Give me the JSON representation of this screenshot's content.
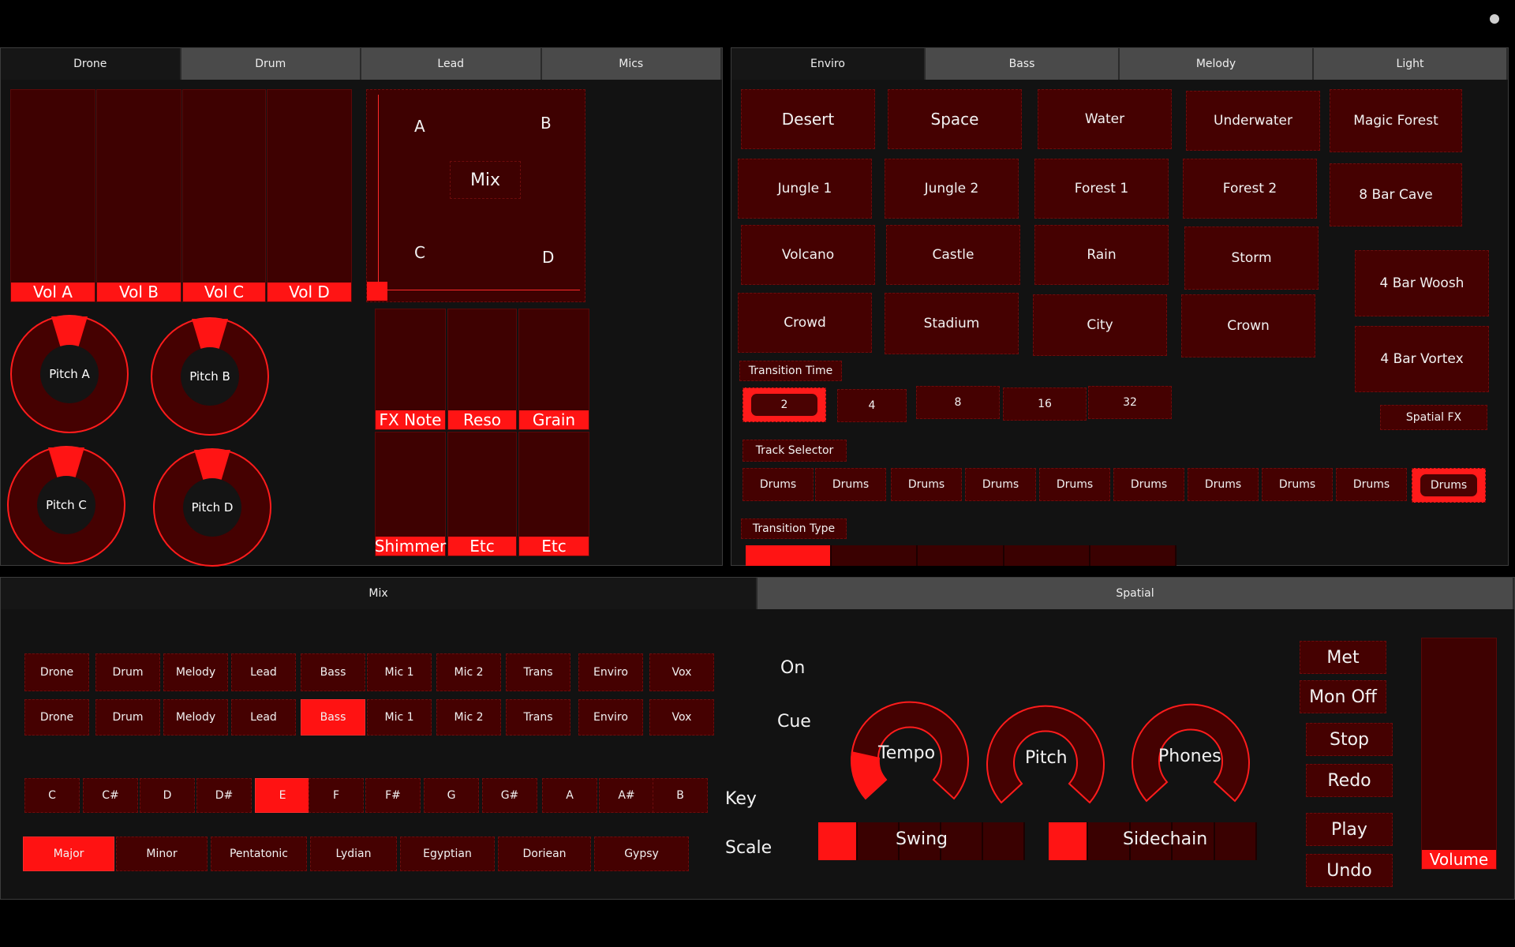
{
  "colors": {
    "accent": "#ff1414",
    "cell": "#450101",
    "cell_dark": "#3a0101",
    "panel": "#121212",
    "tab_inactive": "#4a4a4a"
  },
  "drone_panel": {
    "tabs": [
      "Drone",
      "Drum",
      "Lead",
      "Mics"
    ],
    "active_tab": "Drone",
    "vol_faders": [
      "Vol A",
      "Vol B",
      "Vol C",
      "Vol D"
    ],
    "xy_pad": {
      "a": "A",
      "b": "B",
      "c": "C",
      "d": "D",
      "center": "Mix"
    },
    "pitch_knobs": [
      "Pitch A",
      "Pitch B",
      "Pitch C",
      "Pitch D"
    ],
    "fx_faders_top": [
      "FX Note",
      "Reso",
      "Grain"
    ],
    "fx_faders_bottom": [
      "Shimmer",
      "Etc",
      "Etc"
    ]
  },
  "enviro_panel": {
    "tabs": [
      "Enviro",
      "Bass",
      "Melody",
      "Light"
    ],
    "active_tab": "Enviro",
    "environments": [
      "Desert",
      "Space",
      "Water",
      "Underwater",
      "Magic Forest",
      "Jungle 1",
      "Jungle 2",
      "Forest 1",
      "Forest 2",
      "8 Bar Cave",
      "Volcano",
      "Castle",
      "Rain",
      "Storm",
      "4 Bar Woosh",
      "Crowd",
      "Stadium",
      "City",
      "Crown",
      "4 Bar Vortex"
    ],
    "transition_time_label": "Transition Time",
    "transition_times": [
      "2",
      "4",
      "8",
      "16",
      "32"
    ],
    "transition_time_selected": "2",
    "spatial_fx_label": "Spatial FX",
    "track_selector_label": "Track Selector",
    "tracks": [
      "Drums",
      "Drums",
      "Drums",
      "Drums",
      "Drums",
      "Drums",
      "Drums",
      "Drums",
      "Drums",
      "Drums"
    ],
    "transition_type_label": "Transition Type",
    "transition_type_selected_index": 0
  },
  "mix_panel": {
    "tabs": [
      "Mix",
      "Spatial"
    ],
    "active_tab": "Mix",
    "channels_on": [
      "Drone",
      "Drum",
      "Melody",
      "Lead",
      "Bass",
      "Mic 1",
      "Mic 2",
      "Trans",
      "Enviro",
      "Vox"
    ],
    "channels_cue": [
      "Drone",
      "Drum",
      "Melody",
      "Lead",
      "Bass",
      "Mic 1",
      "Mic 2",
      "Trans",
      "Enviro",
      "Vox"
    ],
    "cue_selected": "Bass",
    "on_label": "On",
    "cue_label": "Cue",
    "keys": [
      "C",
      "C#",
      "D",
      "D#",
      "E",
      "F",
      "F#",
      "G",
      "G#",
      "A",
      "A#",
      "B"
    ],
    "key_selected": "E",
    "key_label": "Key",
    "scales": [
      "Major",
      "Minor",
      "Pentatonic",
      "Lydian",
      "Egyptian",
      "Doriean",
      "Gypsy"
    ],
    "scale_selected": "Major",
    "scale_label": "Scale",
    "knobs": [
      "Tempo",
      "Pitch",
      "Phones"
    ],
    "tempo_level": 0.2,
    "swing_label": "Swing",
    "sidechain_label": "Sidechain",
    "transport": [
      "Met",
      "Mon Off",
      "Stop",
      "Redo",
      "Play",
      "Undo"
    ],
    "volume_label": "Volume"
  }
}
